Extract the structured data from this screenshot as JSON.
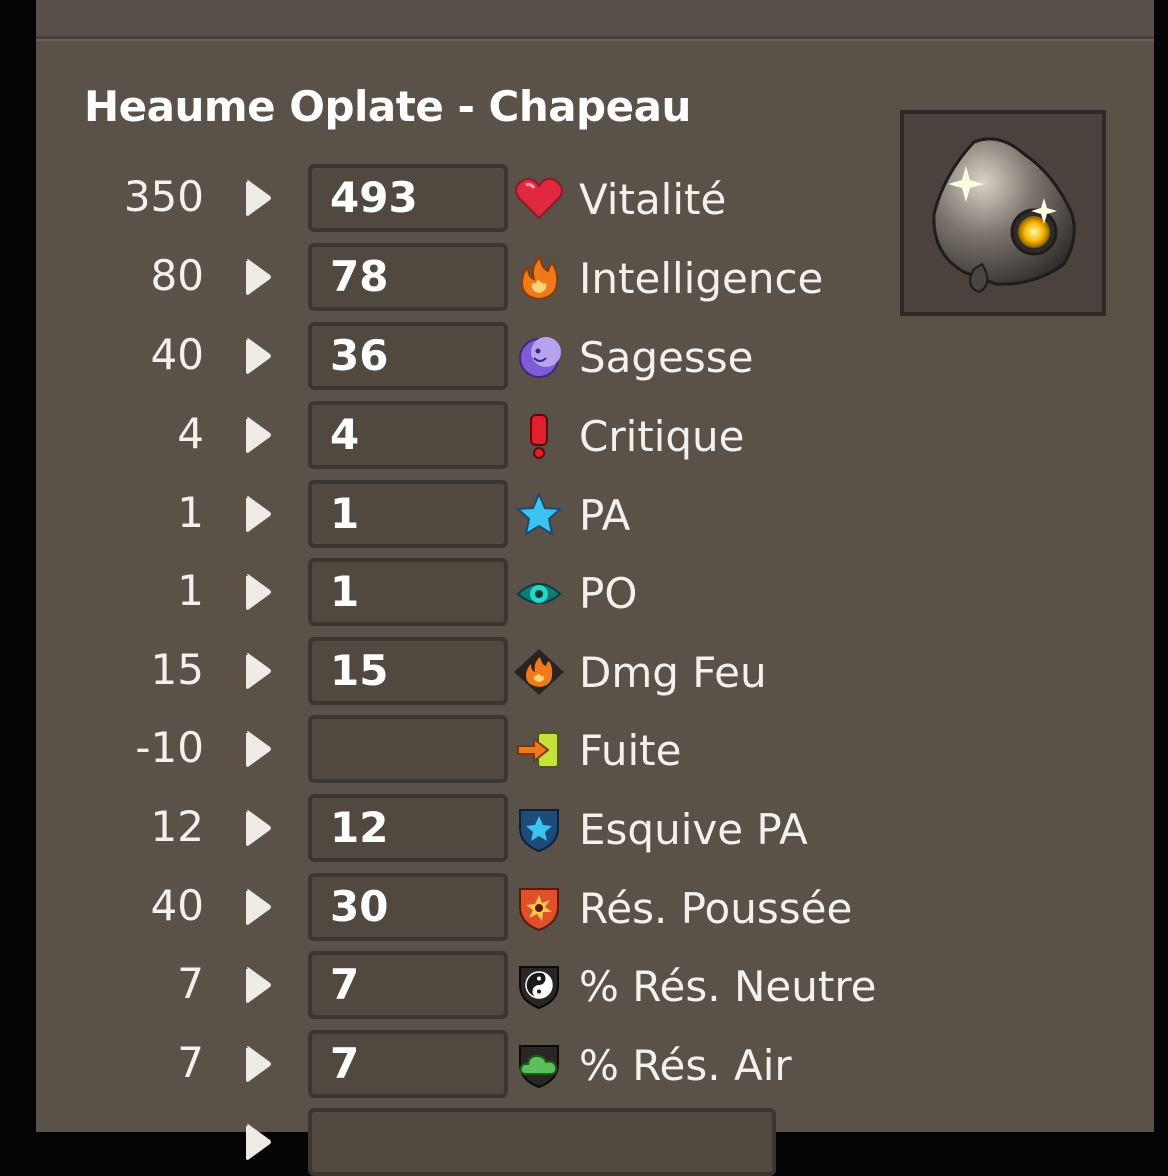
{
  "item": {
    "title": "Heaume Oplate - Chapeau",
    "image_icon": "helmet-icon"
  },
  "stats": [
    {
      "base": "350",
      "value": "493",
      "label": "Vitalité",
      "icon": "heart-icon"
    },
    {
      "base": "80",
      "value": "78",
      "label": "Intelligence",
      "icon": "fire-icon"
    },
    {
      "base": "40",
      "value": "36",
      "label": "Sagesse",
      "icon": "moon-icon"
    },
    {
      "base": "4",
      "value": "4",
      "label": "Critique",
      "icon": "exclamation-icon"
    },
    {
      "base": "1",
      "value": "1",
      "label": "PA",
      "icon": "star-icon"
    },
    {
      "base": "1",
      "value": "1",
      "label": "PO",
      "icon": "eye-icon"
    },
    {
      "base": "15",
      "value": "15",
      "label": "Dmg Feu",
      "icon": "fire-damage-icon"
    },
    {
      "base": "-10",
      "value": "",
      "label": "Fuite",
      "icon": "exit-arrow-icon"
    },
    {
      "base": "12",
      "value": "12",
      "label": "Esquive PA",
      "icon": "shield-star-icon"
    },
    {
      "base": "40",
      "value": "30",
      "label": "Rés. Poussée",
      "icon": "shield-burst-icon"
    },
    {
      "base": "7",
      "value": "7",
      "label": "% Rés. Neutre",
      "icon": "yin-yang-icon"
    },
    {
      "base": "7",
      "value": "7",
      "label": "% Rés. Air",
      "icon": "cloud-icon"
    }
  ],
  "colors": {
    "panel": "#5a5149",
    "outer": "#050505",
    "input_bg": "#51493f",
    "text": "#f4f1ec"
  }
}
